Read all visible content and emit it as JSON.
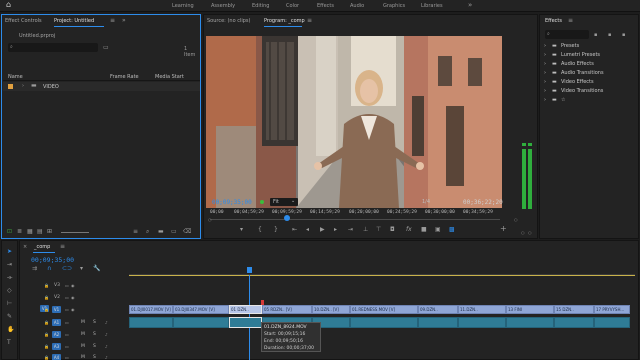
{
  "workspace_tabs": [
    "Learning",
    "Assembly",
    "Editing",
    "Color",
    "Effects",
    "Audio",
    "Graphics",
    "Libraries"
  ],
  "more_glyph": "»",
  "left_panel": {
    "tabs": [
      "Effect Controls",
      "Project: Untitled"
    ],
    "project_file": "Untitled.prproj",
    "item_count": "1 Item",
    "columns": {
      "name": "Name",
      "frame_rate": "Frame Rate",
      "media_start": "Media Start"
    },
    "items": [
      {
        "name": "VIDEO",
        "color": "#e0a040"
      }
    ]
  },
  "source_monitor": {
    "tab": "Source: (no clips)"
  },
  "program_monitor": {
    "tab": "Program: _comp",
    "timecode": "00;09;35;00",
    "fit": "Fit",
    "page": "1/4",
    "duration": "00;36;22;20",
    "ruler_ticks": [
      "00;00",
      "00;04;59;29",
      "00;09;59;29",
      "00;14;59;29",
      "00;20;00;00",
      "00;24;59;29",
      "00;30;00;00",
      "00;34;59;29"
    ],
    "playhead_fraction": 0.264
  },
  "effects_panel": {
    "title": "Effects",
    "folders": [
      "Presets",
      "Lumetri Presets",
      "Audio Effects",
      "Audio Transitions",
      "Video Effects",
      "Video Transitions",
      "☆"
    ]
  },
  "timeline": {
    "sequence_name": "_comp",
    "timecode": "00;09;35;00",
    "video_tracks": [
      "V3",
      "V2",
      "V1"
    ],
    "audio_tracks": [
      "A1",
      "A2",
      "A3",
      "A4"
    ],
    "clips": [
      "01.DJI0017.MOV [V]",
      "03.DJI0347.MOV [V]",
      "01 DZN..",
      "05 RDZN.. [V]",
      "10.DZN.. [V]",
      "01.REDNESS.MOV [V]",
      "09.DZN..",
      "11.DZN..",
      "13 FINI",
      "15 DZN..",
      "17 PRYVYSH..."
    ],
    "tooltip": {
      "name": "01.DZN_8924.MOV",
      "start": "Start: 00;09;15;16",
      "end": "End: 00;09;50;16",
      "duration": "Duration: 00;00;37;00"
    }
  },
  "colors": {
    "accent": "#2d8ceb",
    "video_clip": "#8fa6d6",
    "audio_clip": "#2f7c96",
    "track_highlight": "#2d6db5",
    "meter_green": "#2fae3d"
  }
}
